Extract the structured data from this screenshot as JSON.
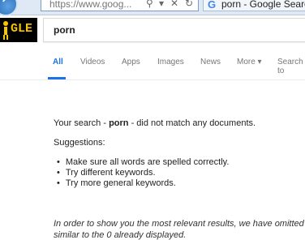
{
  "browser": {
    "address": "https://www.goog...",
    "tab_title": "porn - Google Search"
  },
  "logo": {
    "text": "GLE"
  },
  "search": {
    "query": "porn"
  },
  "tabs": [
    {
      "label": "All",
      "active": true
    },
    {
      "label": "Videos"
    },
    {
      "label": "Apps"
    },
    {
      "label": "Images"
    },
    {
      "label": "News"
    },
    {
      "label": "More ▾"
    },
    {
      "label": "Search to"
    }
  ],
  "result": {
    "prefix": "Your search - ",
    "query": "porn",
    "suffix": " - did not match any documents.",
    "suggestions_heading": "Suggestions:",
    "suggestions": [
      "Make sure all words are spelled correctly.",
      "Try different keywords.",
      "Try more general keywords."
    ],
    "omitted_line1": "In order to show you the most relevant results, we have omitted",
    "omitted_line2": "similar to the 0 already displayed."
  },
  "colors": {
    "accent": "#1a73e8",
    "logo_bg": "#000000",
    "logo_text": "#f6c400"
  }
}
